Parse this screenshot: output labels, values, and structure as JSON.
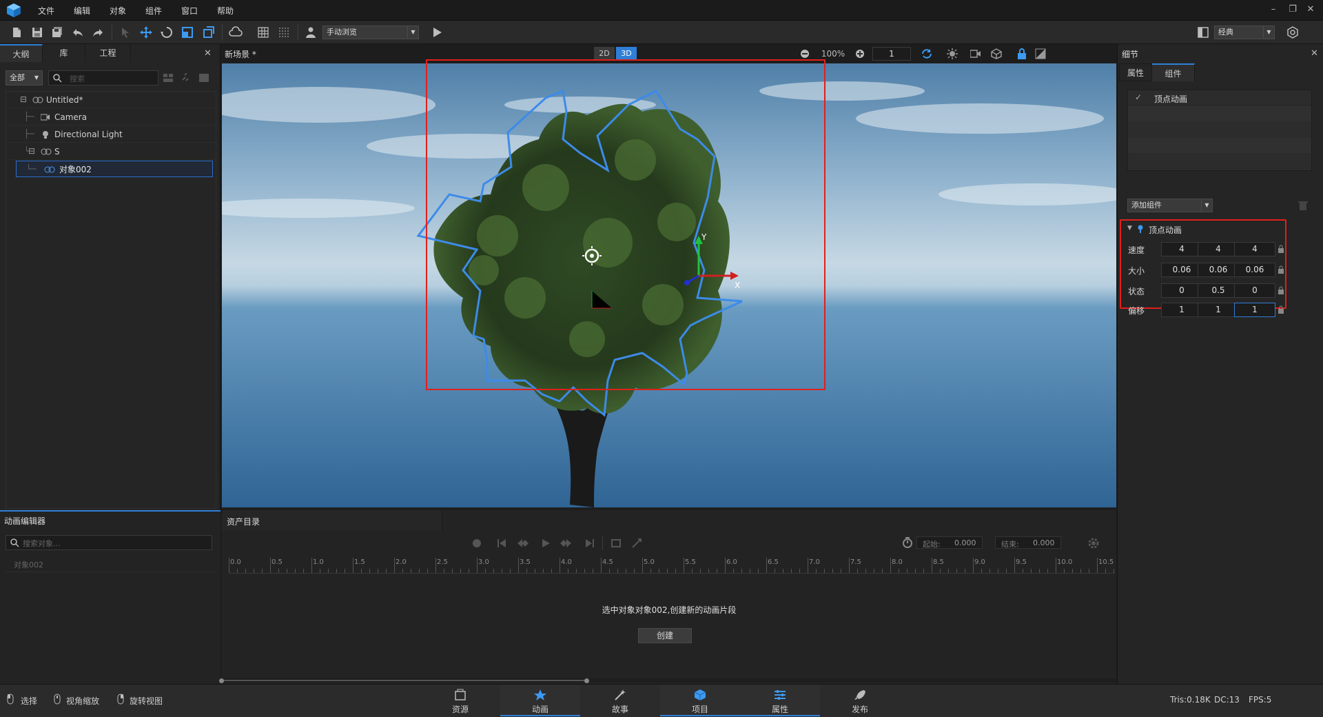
{
  "menu": [
    "文件",
    "编辑",
    "对象",
    "组件",
    "窗口",
    "帮助"
  ],
  "toolbar": {
    "view_mode": "手动浏览",
    "layout_preset": "经典"
  },
  "outline": {
    "tabs": [
      "大纲",
      "库",
      "工程"
    ],
    "filter": "全部",
    "search_placeholder": "搜索",
    "tree": [
      {
        "label": "Untitled*"
      },
      {
        "label": "Camera"
      },
      {
        "label": "Directional Light"
      },
      {
        "label": "S"
      },
      {
        "label": "对象002"
      }
    ]
  },
  "viewport": {
    "title": "新场景 *",
    "mode_2d": "2D",
    "mode_3d": "3D",
    "zoom": "100%",
    "frame": "1",
    "gizmo_x": "X",
    "gizmo_y": "Y"
  },
  "details": {
    "title": "细节",
    "tabs": [
      "属性",
      "组件"
    ],
    "component_list": [
      "顶点动画"
    ],
    "add_component": "添加组件",
    "section_title": "顶点动画",
    "props": [
      {
        "label": "速度",
        "values": [
          "4",
          "4",
          "4"
        ]
      },
      {
        "label": "大小",
        "values": [
          "0.06",
          "0.06",
          "0.06"
        ]
      },
      {
        "label": "状态",
        "values": [
          "0",
          "0.5",
          "0"
        ]
      },
      {
        "label": "偏移",
        "values": [
          "1",
          "1",
          "1"
        ]
      }
    ]
  },
  "anim_editor": {
    "title": "动画编辑器",
    "search_placeholder": "搜索对象...",
    "object": "对象002"
  },
  "assets": {
    "tab": "资产目录",
    "start_label": "起始:",
    "start_value": "0.000",
    "end_label": "结束:",
    "end_value": "0.000",
    "ruler": [
      "0.0",
      "0.5",
      "1.0",
      "1.5",
      "2.0",
      "2.5",
      "3.0",
      "3.5",
      "4.0",
      "4.5",
      "5.0",
      "5.5",
      "6.0",
      "6.5",
      "7.0",
      "7.5",
      "8.0",
      "8.5",
      "9.0",
      "9.5",
      "10.0",
      "10.5"
    ],
    "message": "选中对象对象002,创建新的动画片段",
    "create_button": "创建"
  },
  "status": {
    "tools": [
      "选择",
      "视角缩放",
      "旋转视图"
    ],
    "nav": [
      "资源",
      "动画",
      "故事",
      "项目",
      "属性",
      "发布"
    ],
    "tris": "Tris:0.18K",
    "dc": "DC:13",
    "fps": "FPS:5"
  },
  "colors": {
    "accent": "#2f7fd8",
    "highlight_box": "#e0201c",
    "selection_outline": "#3d8be8"
  }
}
